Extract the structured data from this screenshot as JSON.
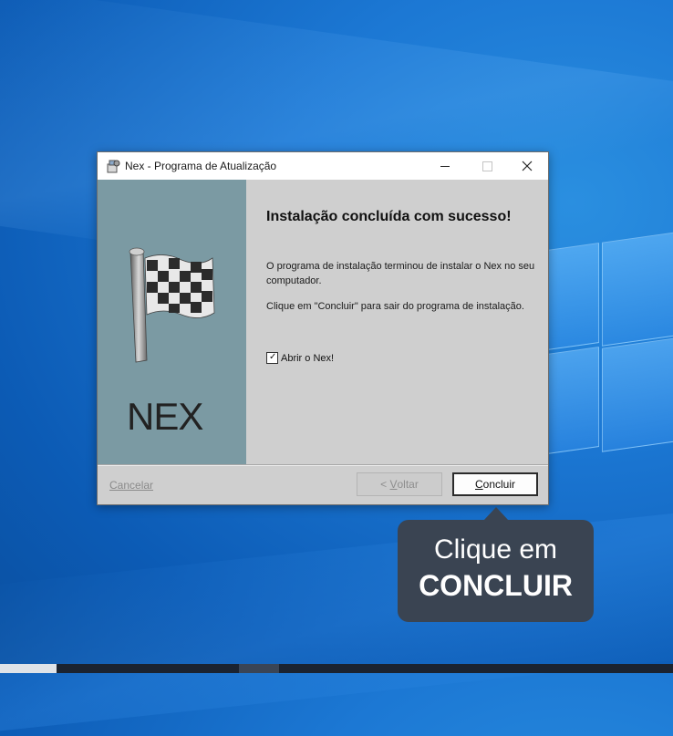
{
  "window": {
    "title": "Nex - Programa de Atualização",
    "controls": [
      "minimize",
      "maximize",
      "close"
    ]
  },
  "side_panel": {
    "logo_text": "NEX",
    "icon": "checkered-flag-icon"
  },
  "content": {
    "heading": "Instalação concluída com sucesso!",
    "paragraph1": "O programa de instalação terminou de instalar o Nex no seu computador.",
    "paragraph2": "Clique em \"Concluir\" para sair do programa de instalação.",
    "checkbox": {
      "label": "Abrir o Nex!",
      "checked": true
    }
  },
  "footer": {
    "cancel_label": "Cancelar",
    "back_prefix": "< ",
    "back_accel": "V",
    "back_rest": "oltar",
    "finish_accel": "C",
    "finish_rest": "oncluir"
  },
  "callout": {
    "line1": "Clique em",
    "line2": "CONCLUIR"
  },
  "colors": {
    "desktop": "#1c78d4",
    "side_panel": "#7b9aa3",
    "dialog_bg": "#cfcfcf",
    "callout_bg": "#3a4452"
  }
}
